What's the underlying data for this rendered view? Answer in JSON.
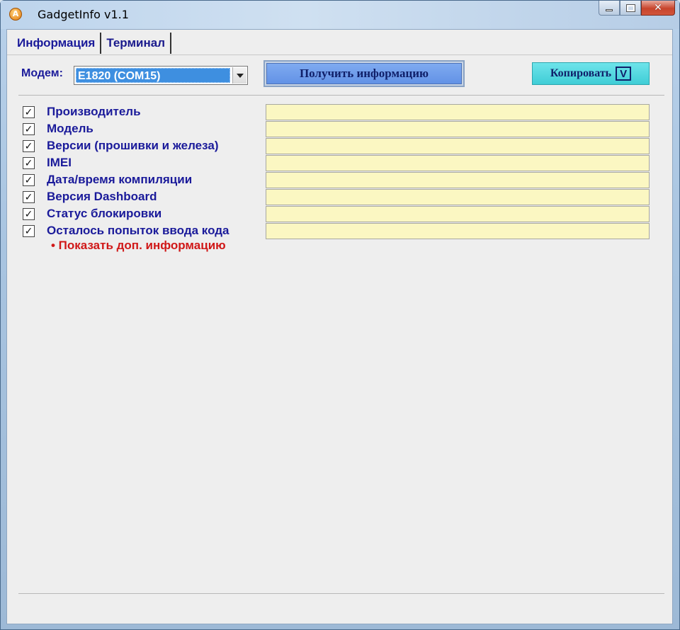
{
  "window": {
    "title": "GadgetInfo v1.1",
    "app_icon_letter": "A",
    "app_icon": "app-logo-icon",
    "controls": {
      "minimize_icon": "minimize-icon",
      "maximize_icon": "maximize-icon",
      "close_icon": "close-icon",
      "close_glyph": "✕"
    }
  },
  "tabs": [
    {
      "label": "Информация",
      "active": true
    },
    {
      "label": "Терминал",
      "active": false
    }
  ],
  "modem": {
    "label": "Модем:",
    "selected": "E1820 (COM15)",
    "dropdown_icon": "chevron-down-icon"
  },
  "buttons": {
    "get_info": "Получить информацию",
    "copy": "Копировать",
    "copy_suffix": "V"
  },
  "fields": [
    {
      "label": "Производитель",
      "checked": true,
      "value": ""
    },
    {
      "label": "Модель",
      "checked": true,
      "value": ""
    },
    {
      "label": "Версии (прошивки и железа)",
      "checked": true,
      "value": ""
    },
    {
      "label": "IMEI",
      "checked": true,
      "value": ""
    },
    {
      "label": "Дата/время компиляции",
      "checked": true,
      "value": ""
    },
    {
      "label": "Версия Dashboard",
      "checked": true,
      "value": ""
    },
    {
      "label": "Статус блокировки",
      "checked": true,
      "value": ""
    },
    {
      "label": "Осталось попыток ввода кода",
      "checked": true,
      "value": ""
    }
  ],
  "check_glyph": "✓",
  "more_info_link": "• Показать доп. информацию",
  "colors": {
    "label_text": "#1a1a9a",
    "value_bg": "#fbf7c2",
    "link_red": "#d01818",
    "get_info_bg": "#6292e6",
    "copy_bg": "#3fcdd6"
  }
}
